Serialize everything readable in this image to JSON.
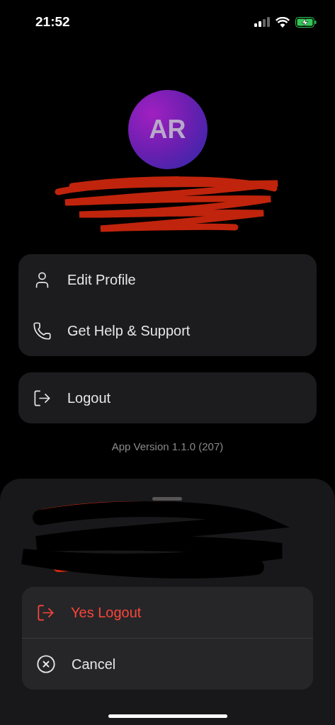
{
  "status_bar": {
    "time": "21:52"
  },
  "profile": {
    "initials": "AR"
  },
  "menu_groups": [
    {
      "items": [
        {
          "label": "Edit Profile",
          "kind": "user"
        },
        {
          "label": "Get Help & Support",
          "kind": "phone"
        }
      ]
    },
    {
      "items": [
        {
          "label": "Logout",
          "kind": "logout"
        }
      ]
    }
  ],
  "app_version": "App Version 1.1.0 (207)",
  "logout_sheet": {
    "actions": [
      {
        "label": "Yes Logout",
        "kind": "destructive"
      },
      {
        "label": "Cancel",
        "kind": "cancel"
      }
    ]
  }
}
